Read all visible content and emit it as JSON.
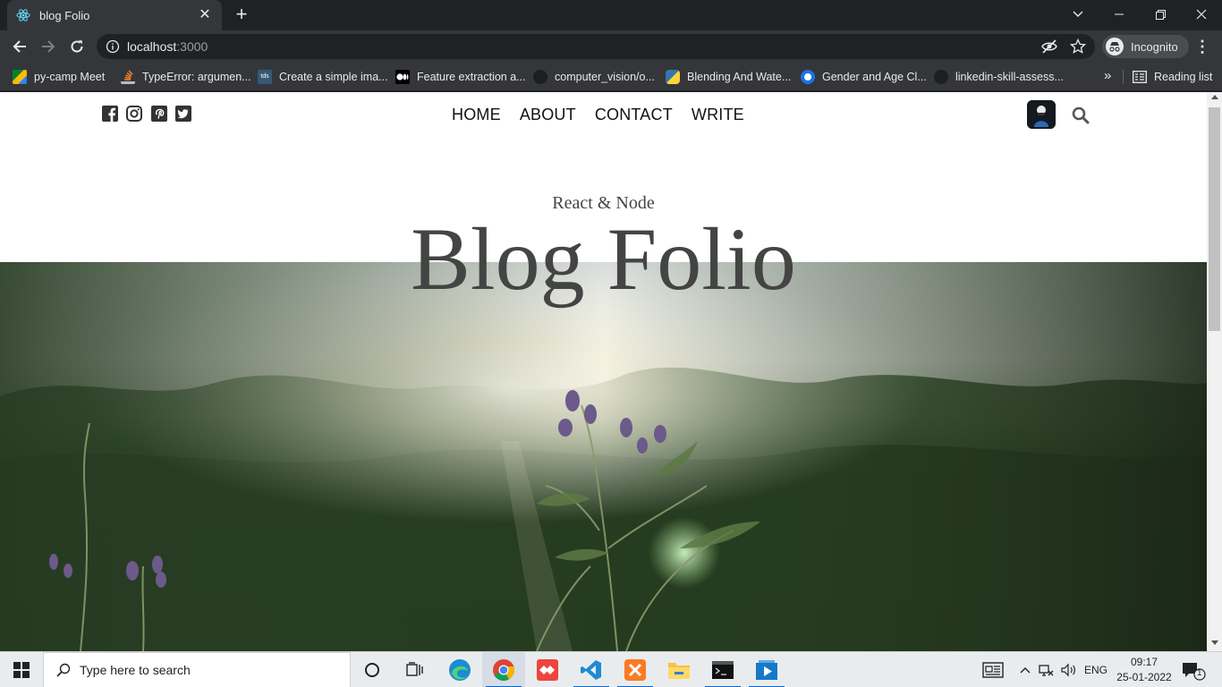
{
  "browser": {
    "tab_title": "blog Folio",
    "url_host": "localhost",
    "url_port": ":3000",
    "profile_label": "Incognito",
    "bookmarks": [
      {
        "label": "py-camp Meet",
        "icon": "google-meet-icon"
      },
      {
        "label": "TypeError: argumen...",
        "icon": "stackoverflow-icon"
      },
      {
        "label": "Create a simple ima...",
        "icon": "tds-icon"
      },
      {
        "label": "Feature extraction a...",
        "icon": "medium-icon"
      },
      {
        "label": "computer_vision/o...",
        "icon": "github-icon"
      },
      {
        "label": "Blending And Wate...",
        "icon": "python-icon"
      },
      {
        "label": "Gender and Age Cl...",
        "icon": "site-icon"
      },
      {
        "label": "linkedin-skill-assess...",
        "icon": "github-icon"
      }
    ],
    "bookmarks_overflow": "»",
    "reading_list_label": "Reading list"
  },
  "page": {
    "social_icons": [
      "facebook-icon",
      "instagram-icon",
      "pinterest-icon",
      "twitter-icon"
    ],
    "nav": [
      "HOME",
      "ABOUT",
      "CONTACT",
      "WRITE"
    ],
    "hero_subtitle": "React & Node",
    "hero_title": "Blog Folio"
  },
  "taskbar": {
    "search_placeholder": "Type here to search",
    "language": "ENG",
    "time": "09:17",
    "date": "25-01-2022",
    "notification_count": "1"
  }
}
